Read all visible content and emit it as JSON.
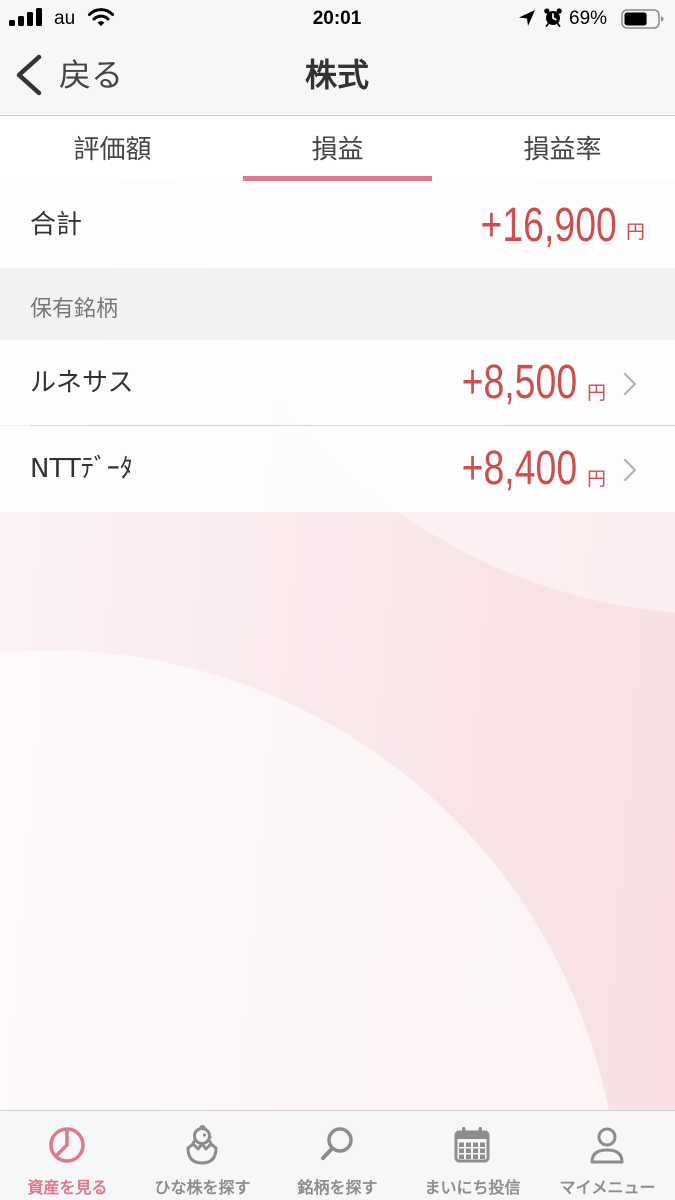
{
  "status_bar": {
    "carrier": "au",
    "time": "20:01",
    "battery_text": "69%",
    "battery_level": 0.69,
    "signal_bars": 4
  },
  "nav": {
    "back_label": "戻る",
    "title": "株式"
  },
  "tabs": [
    {
      "label": "評価額",
      "selected": false
    },
    {
      "label": "損益",
      "selected": true
    },
    {
      "label": "損益率",
      "selected": false
    }
  ],
  "total": {
    "label": "合計",
    "value": "+16,900",
    "unit": "円"
  },
  "holdings": {
    "section_title": "保有銘柄",
    "items": [
      {
        "name": "ルネサス",
        "value": "+8,500",
        "unit": "円"
      },
      {
        "name": "NTTﾃﾞｰﾀ",
        "value": "+8,400",
        "unit": "円"
      }
    ]
  },
  "tab_bar": {
    "items": [
      {
        "label": "資産を見る",
        "icon": "pie-chart-icon",
        "active": true
      },
      {
        "label": "ひな株を探す",
        "icon": "hatching-chick-icon",
        "active": false
      },
      {
        "label": "銘柄を探す",
        "icon": "search-icon",
        "active": false
      },
      {
        "label": "まいにち投信",
        "icon": "calendar-icon",
        "active": false
      },
      {
        "label": "マイメニュー",
        "icon": "person-icon",
        "active": false
      }
    ]
  },
  "colors": {
    "accent": "#dc7a8b",
    "gain": "#c9504f",
    "inactive": "#8d8d8d"
  }
}
